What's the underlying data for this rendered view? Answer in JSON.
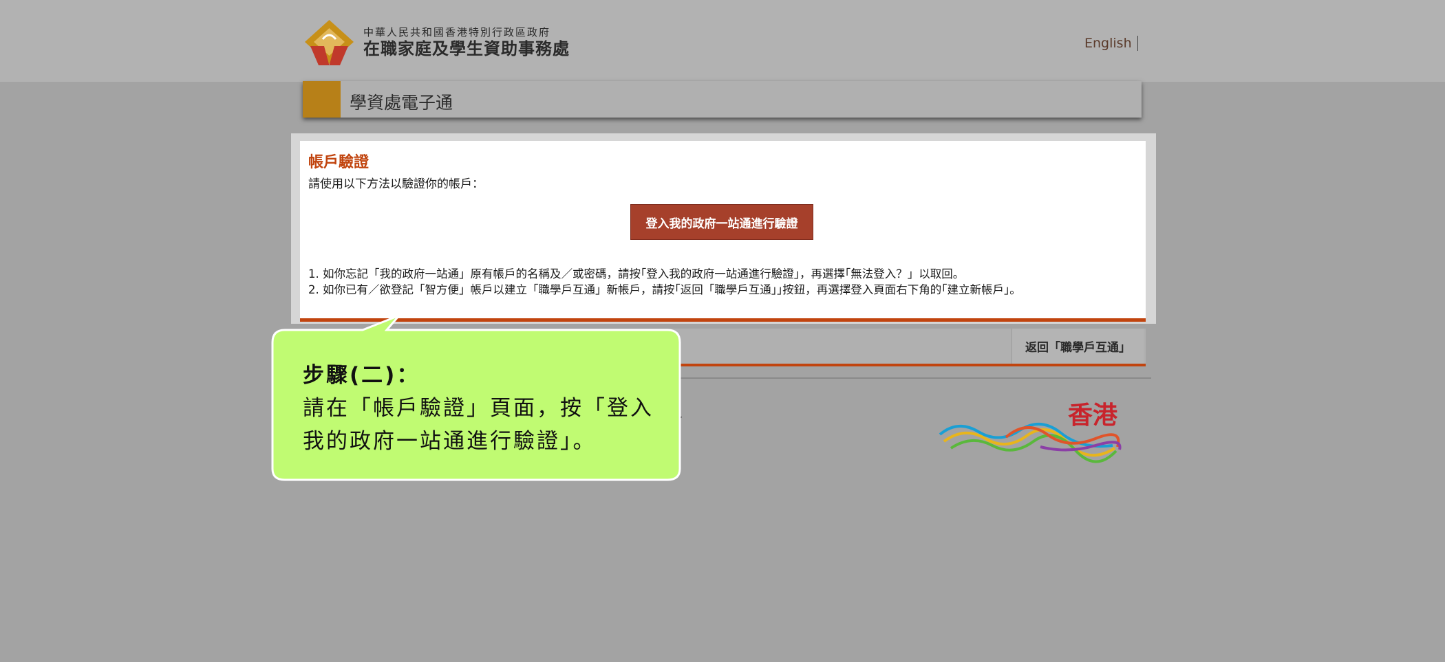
{
  "header": {
    "agency_line1": "中華人民共和國香港特別行政區政府",
    "agency_line2": "在職家庭及學生資助事務處",
    "language_link": "English"
  },
  "title_bar": {
    "title": "學資處電子通"
  },
  "verification": {
    "heading": "帳戶驗證",
    "instruction": "請使用以下方法以驗證你的帳戶：",
    "verify_button": "登入我的政府一站通進行驗證",
    "notes": [
      "1. 如你忘記「我的政府一站通」原有帳戶的名稱及／或密碼，請按｢登入我的政府一站通進行驗證」，再選擇｢無法登入？」以取回。",
      "2. 如你已有／欲登記「智方便」帳戶以建立「職學戶互通」新帳戶，請按｢返回「職學戶互通」｣按鈕，再選擇登入頁面右下角的｢建立新帳戶」。"
    ]
  },
  "subbar": {
    "back_button": "返回「職學戶互通」"
  },
  "footer": {
    "partial_text": "了",
    "brand_text": "香港"
  },
  "callout": {
    "heading": "步驟(二)：",
    "body": "請在「帳戶驗證」頁面，按「登入我的政府一站通進行驗證」。"
  },
  "colors": {
    "accent_gold": "#b78018",
    "accent_orange": "#c1440e",
    "button_red": "#a6402b",
    "callout_green": "#c0fb72"
  }
}
